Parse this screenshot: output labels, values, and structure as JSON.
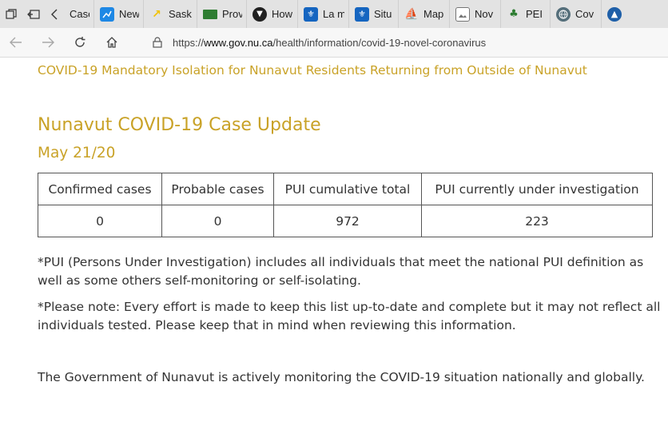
{
  "browser": {
    "tabs": [
      {
        "label": "Case",
        "icon": "document-icon",
        "color": "#ffffff"
      },
      {
        "label": "New",
        "icon": "news-chart-icon",
        "color": "#1e88e5"
      },
      {
        "label": "Sask",
        "icon": "banana-icon",
        "color": "#f2c200"
      },
      {
        "label": "Prov",
        "icon": "flag-icon",
        "color": "#2e7d32"
      },
      {
        "label": "How",
        "icon": "shield-icon",
        "color": "#212121"
      },
      {
        "label": "La m",
        "icon": "fleur-de-lis-icon",
        "color": "#1565c0"
      },
      {
        "label": "Situ",
        "icon": "fleur-de-lis-icon",
        "color": "#1565c0"
      },
      {
        "label": "Map",
        "icon": "sailboat-icon",
        "color": "#c62828"
      },
      {
        "label": "Nov",
        "icon": "image-icon",
        "color": "#757575"
      },
      {
        "label": "PEI (",
        "icon": "pei-logo-icon",
        "color": "#2e7d32"
      },
      {
        "label": "Cov",
        "icon": "globe-icon",
        "color": "#546e7a"
      }
    ],
    "url_prefix": "https://",
    "url_host": "www.gov.nu.ca",
    "url_path": "/health/information/covid-19-novel-coronavirus"
  },
  "page": {
    "top_link": "COVID-19 Mandatory Isolation for Nunavut Residents Returning from Outside of Nunavut",
    "title": "Nunavut COVID-19 Case Update",
    "date": "May 21/20",
    "table": {
      "headers": [
        "Confirmed cases",
        "Probable cases",
        "PUI cumulative total",
        "PUI currently under investigation"
      ],
      "values": [
        "0",
        "0",
        "972",
        "223"
      ]
    },
    "note_pui": "*PUI (Persons Under Investigation) includes all individuals that meet the national PUI definition as well as some others self-monitoring or self-isolating.",
    "note_please": "*Please note: Every effort is made to keep this list up-to-date and complete but it may not reflect all individuals tested. Please keep that in mind when reviewing this information.",
    "paragraph": "The Government of Nunavut is actively monitoring the COVID-19 situation nationally and globally."
  },
  "colors": {
    "accent": "#c9a227",
    "text": "#333333"
  }
}
